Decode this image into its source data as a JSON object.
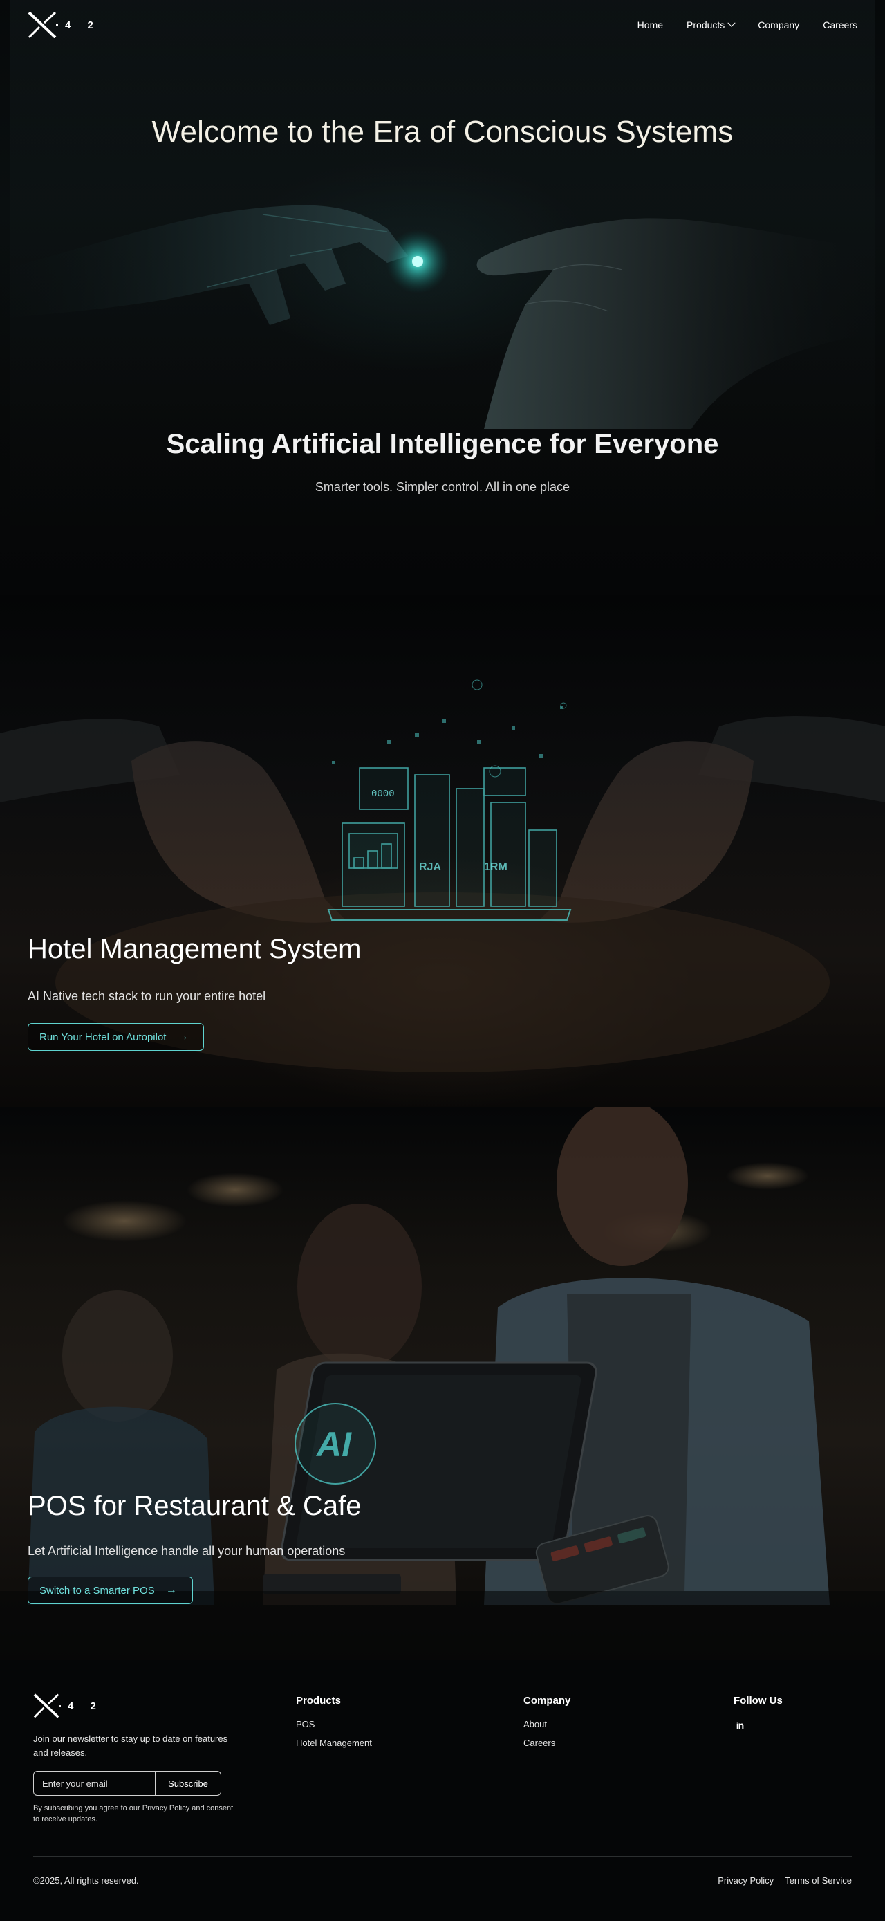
{
  "nav": {
    "logo_digits": "4 2",
    "links": [
      {
        "label": "Home"
      },
      {
        "label": "Products"
      },
      {
        "label": "Company"
      },
      {
        "label": "Careers"
      }
    ]
  },
  "hero": {
    "title": "Welcome to the Era of Conscious Systems",
    "subtitle": "Scaling Artificial Intelligence for Everyone",
    "tagline": "Smarter tools. Simpler control. All in one place"
  },
  "hotel": {
    "title": "Hotel Management System",
    "description": "AI Native tech stack to run your entire hotel",
    "cta": "Run Your Hotel on Autopilot",
    "art_labels": [
      "0000",
      "RJA",
      "1RM"
    ]
  },
  "pos": {
    "title": "POS for Restaurant & Cafe",
    "description": "Let Artificial Intelligence handle all your human operations",
    "cta": "Switch to a Smarter POS",
    "screen_label": "AI"
  },
  "footer": {
    "logo_digits": "4 2",
    "newsletter": "Join our newsletter to stay up to date on features and releases.",
    "email_placeholder": "Enter your email",
    "subscribe": "Subscribe",
    "consent": "By subscribing you agree to our Privacy Policy and consent to receive updates.",
    "columns": {
      "products": {
        "title": "Products",
        "links": [
          "POS",
          "Hotel Management"
        ]
      },
      "company": {
        "title": "Company",
        "links": [
          "About",
          "Careers"
        ]
      },
      "follow": {
        "title": "Follow Us",
        "icon": "linkedin-icon",
        "icon_text": "in"
      }
    },
    "copyright": "©2025, All rights reserved.",
    "legal": [
      "Privacy Policy",
      "Terms of Service"
    ]
  },
  "colors": {
    "accent": "#5fd3cf",
    "background": "#050607",
    "text": "#ffffff"
  }
}
